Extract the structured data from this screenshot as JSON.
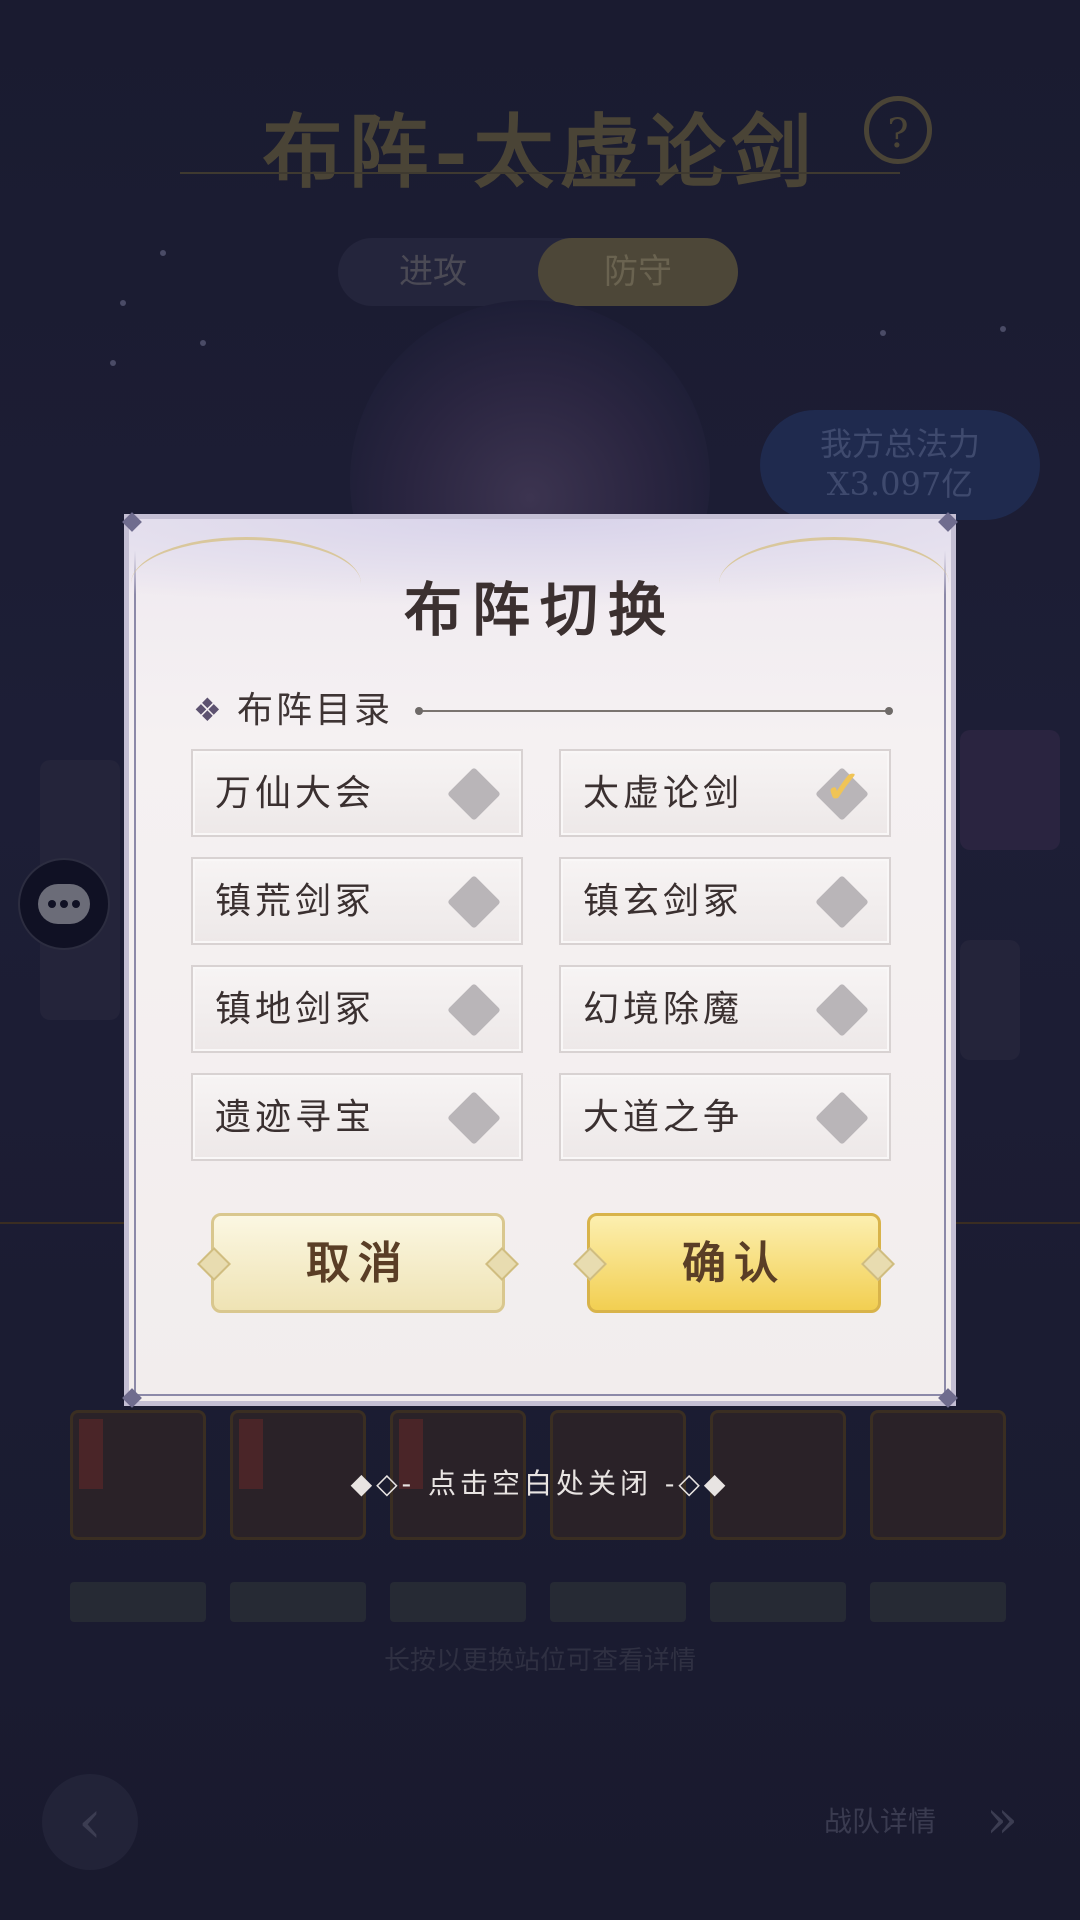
{
  "background": {
    "title": "布阵-太虚论剑",
    "tabs": [
      "进攻",
      "防守"
    ],
    "power_label": "我方总法力",
    "power_value": "X3.097亿",
    "hint": "长按以更换站位可查看详情",
    "more_label": "战队详情"
  },
  "dialog": {
    "title": "布阵切换",
    "section_label": "布阵目录",
    "options": [
      {
        "label": "万仙大会",
        "selected": false
      },
      {
        "label": "太虚论剑",
        "selected": true
      },
      {
        "label": "镇荒剑冢",
        "selected": false
      },
      {
        "label": "镇玄剑冢",
        "selected": false
      },
      {
        "label": "镇地剑冢",
        "selected": false
      },
      {
        "label": "幻境除魔",
        "selected": false
      },
      {
        "label": "遗迹寻宝",
        "selected": false
      },
      {
        "label": "大道之争",
        "selected": false
      }
    ],
    "cancel_label": "取消",
    "confirm_label": "确认"
  },
  "close_hint": "◆◇- 点击空白处关闭 -◇◆",
  "icons": {
    "section": "diamond-cluster-icon",
    "checkbox": "diamond-checkbox-icon",
    "selected": "checkmark-icon",
    "chat": "chat-bubble-icon",
    "help": "help-icon",
    "back": "arrow-left-icon",
    "forward": "double-chevron-right-icon"
  },
  "colors": {
    "overlay": "#15162a",
    "dialog_bg": "#f2eded",
    "confirm_gold": "#f2cf52",
    "check_gold": "#f0c456",
    "text_dark": "#3a3030"
  }
}
